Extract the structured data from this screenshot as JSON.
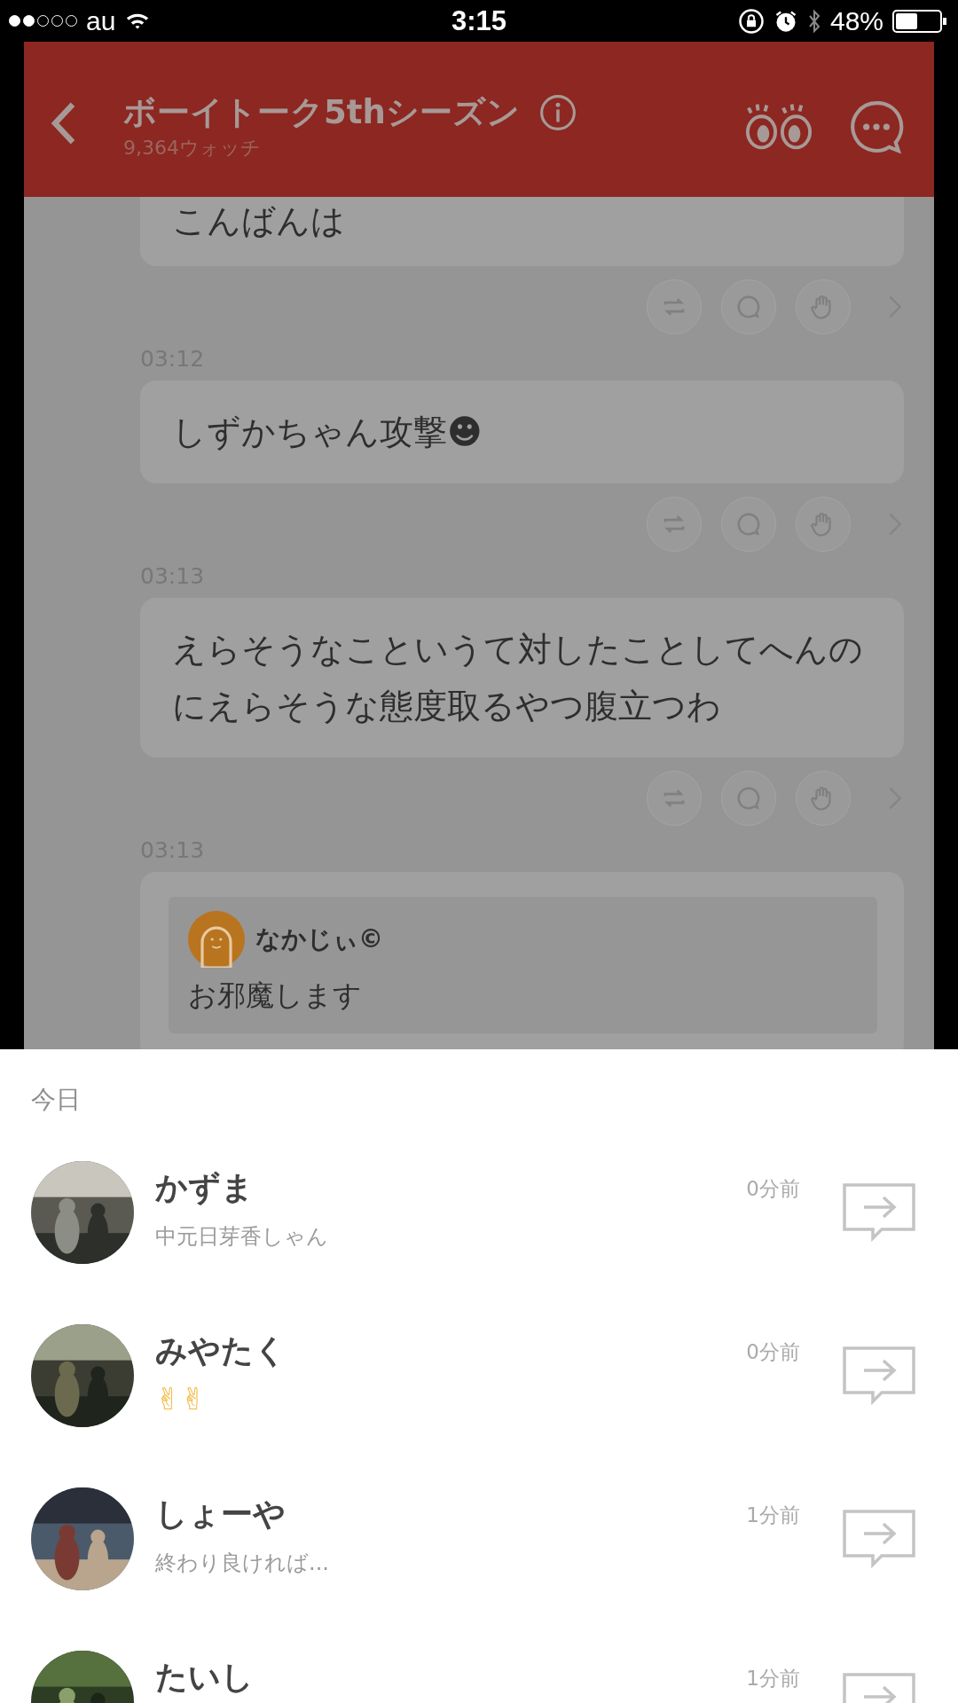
{
  "status_bar": {
    "carrier": "au",
    "time": "3:15",
    "battery": "48%"
  },
  "header": {
    "title": "ボーイトーク5thシーズン",
    "watchers": "9,364ウォッチ"
  },
  "messages": [
    {
      "kind": "text",
      "text": "こんばんは"
    },
    {
      "kind": "text",
      "time": "03:12",
      "text": "しずかちゃん攻撃☻"
    },
    {
      "kind": "text",
      "time": "03:13",
      "text": "えらそうなこというて対したことしてへんのにえらそうな態度取るやつ腹立つわ"
    },
    {
      "kind": "quote",
      "time": "03:13",
      "author": "なかじぃ©",
      "text": "お邪魔します"
    }
  ],
  "sheet": {
    "section": "今日",
    "users": [
      {
        "name": "かずま",
        "preview": "中元日芽香しゃん",
        "time": "0分前",
        "kind": "text"
      },
      {
        "name": "みやたく",
        "preview": "✌✌",
        "time": "0分前",
        "kind": "emoji"
      },
      {
        "name": "しょーや",
        "preview": "終わり良ければ...",
        "time": "1分前",
        "kind": "text"
      },
      {
        "name": "たいし",
        "time": "1分前"
      }
    ]
  }
}
